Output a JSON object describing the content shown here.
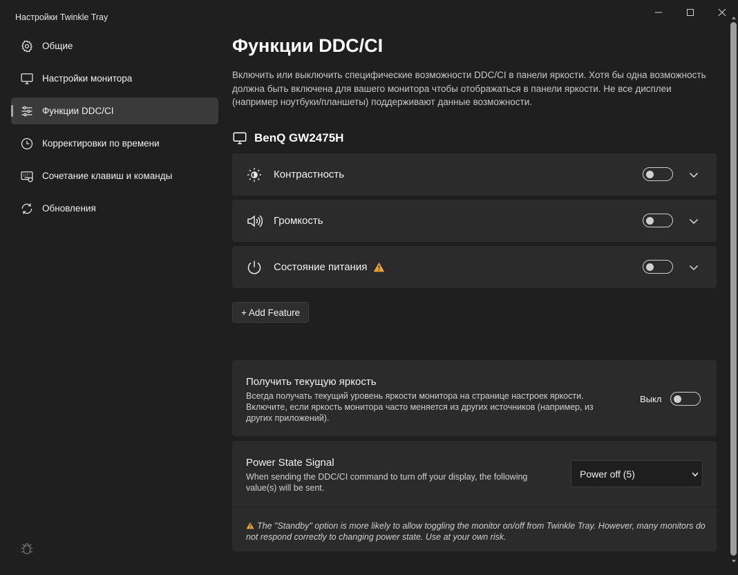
{
  "window": {
    "title": "Настройки Twinkle Tray"
  },
  "sidebar": {
    "items": [
      {
        "label": "Общие",
        "icon": "gear-icon"
      },
      {
        "label": "Настройки монитора",
        "icon": "monitor-icon"
      },
      {
        "label": "Функции DDC/CI",
        "icon": "sliders-icon",
        "active": true
      },
      {
        "label": "Корректировки по времени",
        "icon": "clock-icon"
      },
      {
        "label": "Сочетание клавиш и команды",
        "icon": "keyboard-icon"
      },
      {
        "label": "Обновления",
        "icon": "refresh-icon"
      }
    ]
  },
  "main": {
    "title": "Функции DDC/CI",
    "description": "Включить или выключить специфические возможности DDC/CI в панели яркости. Хотя бы одна возможность должна быть включена для вашего монитора чтобы отображаться в панели яркости. Не все дисплеи (например ноутбуки/планшеты) поддерживают данные возможности.",
    "monitor_name": "BenQ GW2475H",
    "features": [
      {
        "label": "Контрастность",
        "icon": "contrast-icon",
        "enabled": false
      },
      {
        "label": "Громкость",
        "icon": "volume-icon",
        "enabled": false
      },
      {
        "label": "Состояние питания",
        "icon": "power-icon",
        "enabled": false,
        "warning": true
      }
    ],
    "add_feature_label": "+ Add Feature",
    "get_brightness": {
      "title": "Получить текущую яркость",
      "description": "Всегда получать текущий уровень яркости монитора на странице настроек яркости. Включите, если яркость монитора часто меняется из других источников (например, из других приложений).",
      "state_label": "Выкл",
      "enabled": false
    },
    "power_state": {
      "title": "Power State Signal",
      "description": "When sending the DDC/CI command to turn off your display, the following value(s) will be sent.",
      "selected": "Power off (5)",
      "warning_text": "The \"Standby\" option is more likely to allow toggling the monitor on/off from Twinkle Tray. However, many monitors do not respond correctly to changing power state. Use at your own risk."
    }
  },
  "colors": {
    "background": "#1f1f1f",
    "card": "#2b2b2b",
    "warning": "#e8a33d"
  }
}
